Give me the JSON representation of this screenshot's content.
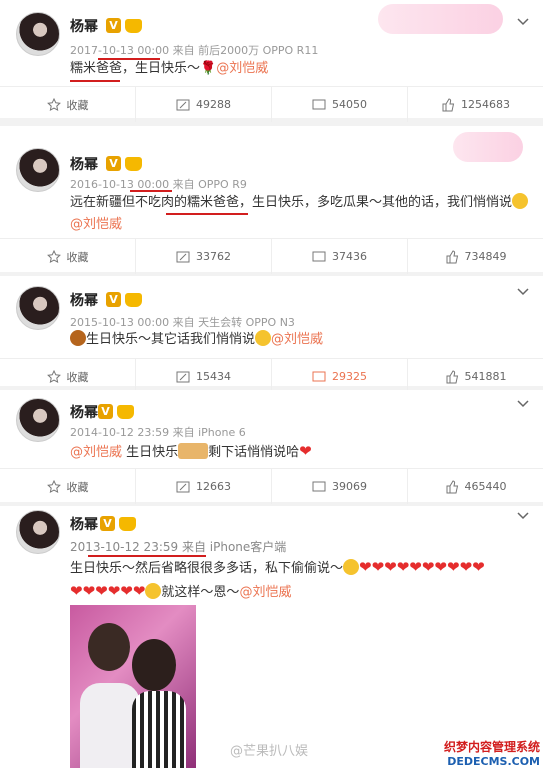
{
  "user_name": "杨幂",
  "verified_badge": "V",
  "icons": {
    "favorite": "star-icon",
    "comment": "comment-icon",
    "repost": "repost-icon",
    "like": "thumb-up-icon",
    "more": "chevron-down-icon"
  },
  "colors": {
    "mention": "#eb7350",
    "underline": "#d21e1e",
    "heart": "#e52d2d"
  },
  "posts": [
    {
      "meta": "2017-10-13 00:00 来自 前后2000万 OPPO R11",
      "text_a": "糯米爸爸，生日快乐～🌹",
      "mention": "@刘恺威",
      "actions": {
        "fav": "收藏",
        "repost": "49288",
        "comment": "54050",
        "like": "1254683"
      }
    },
    {
      "meta": "2016-10-13 00:00 来自 OPPO R9",
      "text_a": "远在新疆但不吃肉的糯米爸爸，生日快乐，多吃瓜果～其他的话，我们悄悄说",
      "mention": "@刘恺威",
      "actions": {
        "fav": "收藏",
        "repost": "33762",
        "comment": "37436",
        "like": "734849"
      }
    },
    {
      "meta": "2015-10-13 00:00 来自 天生会转 OPPO N3",
      "text_a": "生日快乐～其它话我们悄悄说",
      "mention": "@刘恺威",
      "actions": {
        "fav": "收藏",
        "repost": "15434",
        "comment": "29325",
        "like": "541881"
      }
    },
    {
      "meta": "2014-10-12 23:59 来自 iPhone 6",
      "mention": "@刘恺威",
      "text_a": " 生日快乐",
      "text_b": "剩下话悄悄说哈",
      "actions": {
        "fav": "收藏",
        "repost": "12663",
        "comment": "39069",
        "like": "465440"
      }
    },
    {
      "meta": "2013-10-12 23:59 来自 iPhone客户端",
      "text_a": "生日快乐～然后省略很很多多话，私下偷偷说～",
      "text_b": "就这样～恩～",
      "mention": "@刘恺威"
    }
  ],
  "watermark": "@芒果扒八娱",
  "corner_mark": {
    "line1": "织梦内容管理系统",
    "line2": "DEDECMS.COM"
  }
}
